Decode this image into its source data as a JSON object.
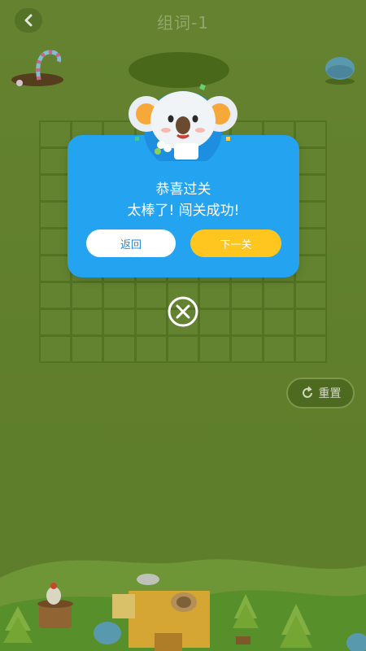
{
  "header": {
    "title": "组词-1"
  },
  "dialog": {
    "line1": "恭喜过关",
    "line2": "太棒了! 闯关成功!",
    "return_label": "返回",
    "next_label": "下一关"
  },
  "controls": {
    "reset_label": "重置"
  },
  "grid": {
    "rows": 9,
    "cols": 9
  },
  "colors": {
    "background": "#6a8a34",
    "dialog": "#24a3f0",
    "next_button": "#ffc61f",
    "return_text": "#1e88d6"
  },
  "icons": [
    "back-arrow-icon",
    "refresh-icon",
    "close-icon"
  ]
}
